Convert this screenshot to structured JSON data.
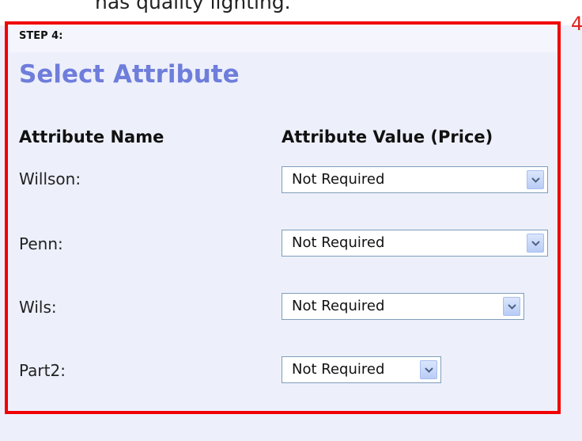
{
  "top_text": "has quality lighting.",
  "callout_number": "4",
  "step_label": "STEP 4:",
  "section_title": "Select Attribute",
  "columns": {
    "name": "Attribute Name",
    "value": "Attribute Value (Price)"
  },
  "rows": [
    {
      "label": "Willson:",
      "selected": "Not Required"
    },
    {
      "label": "Penn:",
      "selected": "Not Required"
    },
    {
      "label": "Wils:",
      "selected": "Not Required"
    },
    {
      "label": "Part2:",
      "selected": "Not Required"
    }
  ],
  "colors": {
    "accent_title": "#6f7ddb",
    "callout_border": "#f00000",
    "panel_bg": "#edf0fb"
  }
}
